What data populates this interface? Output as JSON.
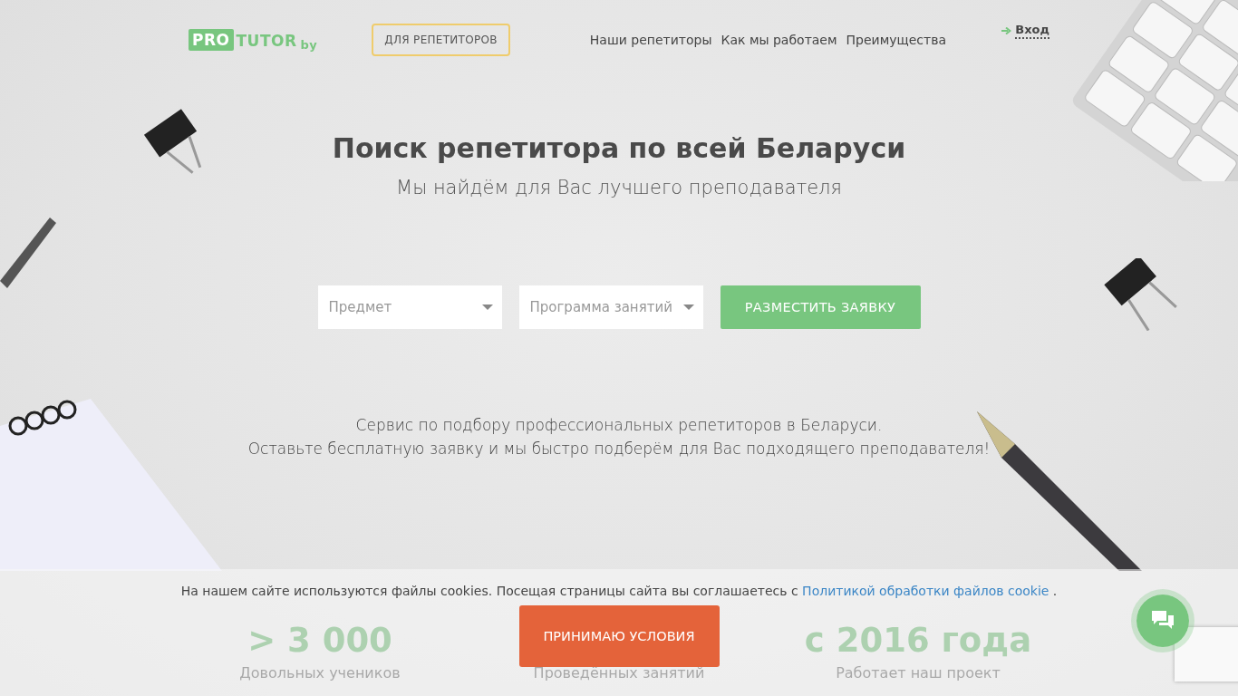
{
  "header": {
    "logo": {
      "box": "PRO",
      "word": "TUTOR",
      "suffix": "by"
    },
    "tutor_button": "ДЛЯ РЕПЕТИТОРОВ",
    "nav": [
      "Наши репетиторы",
      "Как мы работаем",
      "Преимущества"
    ],
    "login": "Вход"
  },
  "hero": {
    "title": "Поиск репетитора по всей Беларуси",
    "subtitle": "Мы найдём для Вас лучшего преподавателя"
  },
  "form": {
    "fields": [
      {
        "placeholder": "Предмет"
      },
      {
        "placeholder": "Программа занятий"
      }
    ],
    "submit": "РАЗМЕСТИТЬ ЗАЯВКУ"
  },
  "description": [
    "Сервис по подбору профессиональных репетиторов в Беларуси.",
    "Оставьте бесплатную заявку и мы быстро подберём для Вас подходящего преподавателя!"
  ],
  "stats": [
    {
      "value": "> 3 000",
      "label": "Довольных учеников"
    },
    {
      "label": "Проведённых занятий"
    },
    {
      "value": "с 2016 года",
      "label": "Работает наш проект"
    }
  ],
  "cookie_bar": {
    "text": "На нашем сайте используются файлы cookies. Посещая страницы сайта вы соглашаетесь с",
    "link": "Политикой обработки файлов cookie",
    "end": ".",
    "accept": "ПРИНИМАЮ УСЛОВИЯ"
  }
}
